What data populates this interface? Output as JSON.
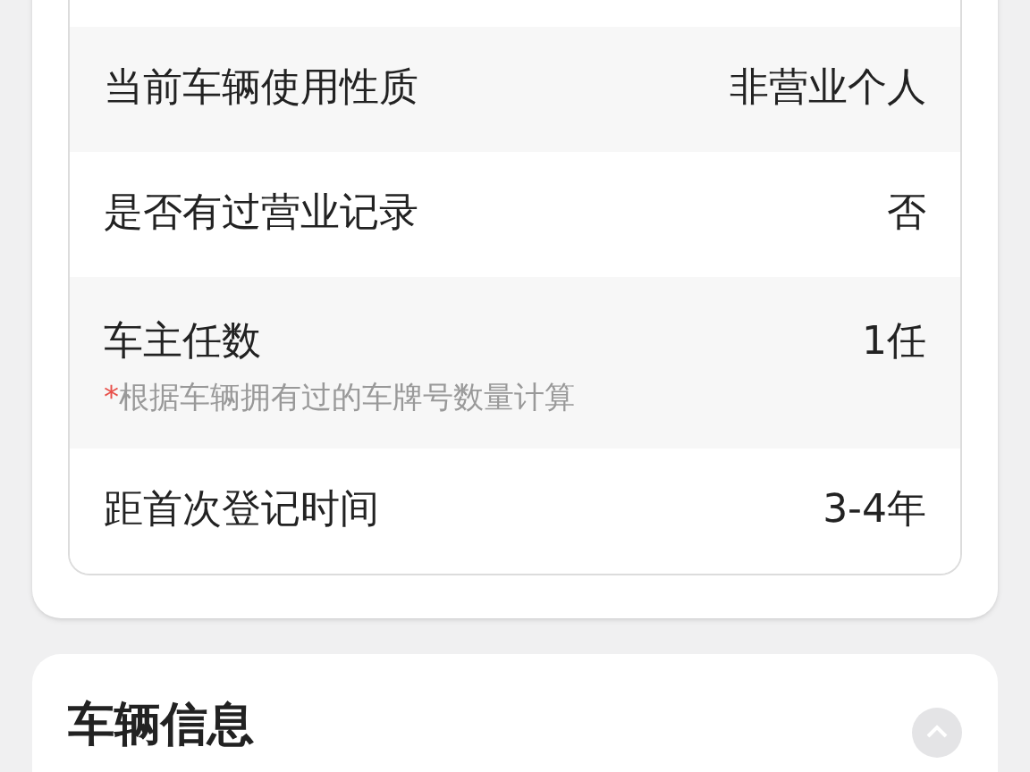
{
  "rows": [
    {
      "label": "当前车辆使用性质",
      "value": "非营业个人"
    },
    {
      "label": "是否有过营业记录",
      "value": "否"
    },
    {
      "label": "车主任数",
      "value": "1任",
      "note_mark": "*",
      "note": "根据车辆拥有过的车牌号数量计算"
    },
    {
      "label": "距首次登记时间",
      "value": "3-4年"
    }
  ],
  "section": {
    "title": "车辆信息",
    "expanded": true
  }
}
